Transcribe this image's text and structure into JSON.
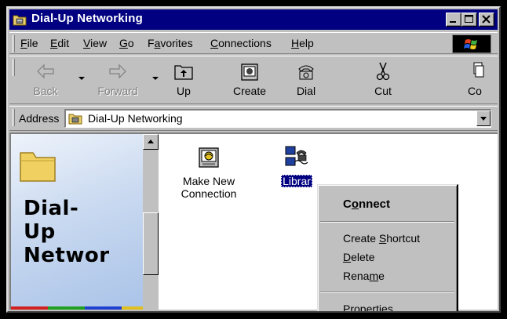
{
  "window": {
    "title": "Dial-Up Networking",
    "icon": "dialup-folder-icon"
  },
  "menu": {
    "items": [
      {
        "pre": "",
        "ul": "F",
        "post": "ile"
      },
      {
        "pre": "",
        "ul": "E",
        "post": "dit"
      },
      {
        "pre": "",
        "ul": "V",
        "post": "iew"
      },
      {
        "pre": "",
        "ul": "G",
        "post": "o"
      },
      {
        "pre": "F",
        "ul": "a",
        "post": "vorites"
      },
      {
        "pre": "",
        "ul": "C",
        "post": "onnections"
      },
      {
        "pre": "",
        "ul": "H",
        "post": "elp"
      }
    ]
  },
  "toolbar": {
    "back": "Back",
    "forward": "Forward",
    "up": "Up",
    "create": "Create",
    "dial": "Dial",
    "cut": "Cut",
    "copy": "Co"
  },
  "address": {
    "label": "Address",
    "value": "Dial-Up Networking"
  },
  "leftpane": {
    "title_lines": [
      "Dial-",
      "Up",
      "Networ"
    ]
  },
  "files": {
    "make_new": "Make New Connection",
    "library": "Librar"
  },
  "context_menu": {
    "connect": {
      "pre": "C",
      "ul": "o",
      "post": "nnect"
    },
    "create_shortcut": {
      "pre": "Create ",
      "ul": "S",
      "post": "hortcut"
    },
    "delete": {
      "pre": "",
      "ul": "D",
      "post": "elete"
    },
    "rename": {
      "pre": "Rena",
      "ul": "m",
      "post": "e"
    },
    "properties": {
      "pre": "P",
      "ul": "r",
      "post": "operties"
    }
  },
  "colors": {
    "titlebar": "#000080",
    "face": "#c0c0c0",
    "selection": "#000080"
  }
}
